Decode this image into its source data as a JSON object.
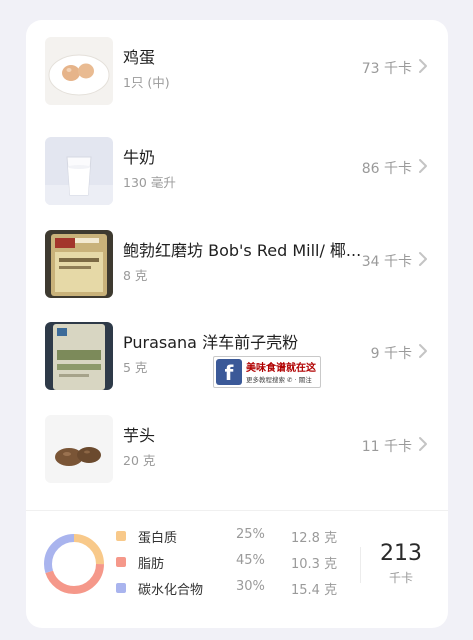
{
  "foods": [
    {
      "name": "鸡蛋",
      "amount": "1只 (中)",
      "kcal": "73 千卡",
      "icon": "egg-image"
    },
    {
      "name": "牛奶",
      "amount": "130 毫升",
      "kcal": "86 千卡",
      "icon": "milk-image"
    },
    {
      "name": "鲍勃红磨坊 Bob's Red Mill/ 椰...",
      "amount": "8 克",
      "kcal": "34 千卡",
      "icon": "bobs-red-mill-package-image"
    },
    {
      "name": "Purasana 洋车前子壳粉",
      "amount": "5 克",
      "kcal": "9 千卡",
      "icon": "psyllium-package-image"
    },
    {
      "name": "芋头",
      "amount": "20 克",
      "kcal": "11 千卡",
      "icon": "taro-image"
    }
  ],
  "nutrition": {
    "macros": [
      {
        "label": "蛋白质",
        "percent": "25%",
        "grams": "12.8 克",
        "color": "#f8c98a",
        "fraction": 0.25
      },
      {
        "label": "脂肪",
        "percent": "45%",
        "grams": "10.3 克",
        "color": "#f5988a",
        "fraction": 0.45
      },
      {
        "label": "碳水化合物",
        "percent": "30%",
        "grams": "15.4 克",
        "color": "#a9b4ee",
        "fraction": 0.3
      }
    ],
    "total_value": "213",
    "total_unit": "千卡"
  },
  "watermark": {
    "logo": "f",
    "title": "美味食谱就在这",
    "subtitle": "更多教程搜索 ✆ · 關注"
  }
}
